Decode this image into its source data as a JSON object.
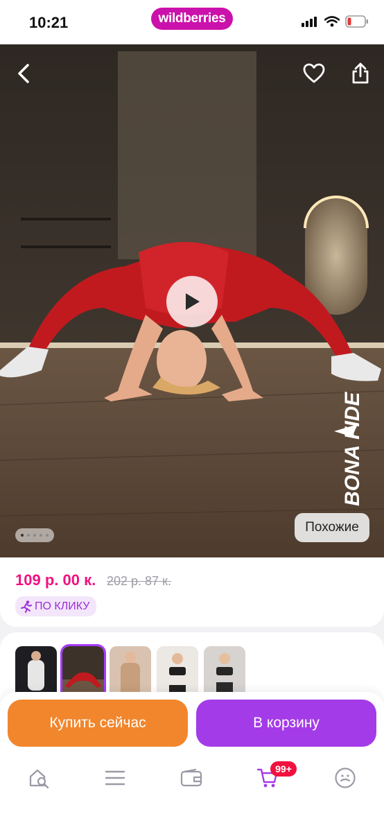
{
  "status_bar": {
    "time": "10:21",
    "brand": "wildberries",
    "icons": [
      "cellular-signal-icon",
      "wifi-icon",
      "battery-low-icon"
    ]
  },
  "hero": {
    "icons": [
      "back-arrow-icon",
      "heart-icon",
      "share-icon",
      "play-icon"
    ],
    "brand_logo": "BONA FIDE",
    "similar_label": "Похожие",
    "gallery_dots_total": 5,
    "gallery_dots_active": 1
  },
  "price": {
    "current": "109 р. 00 к.",
    "old": "202 р. 87 к.",
    "promo_label": "ПО КЛИКУ",
    "promo_icon": "running-person-icon"
  },
  "thumbnails": {
    "count": 5,
    "active_index": 1
  },
  "actions": {
    "buy_now": "Купить сейчас",
    "add_to_cart": "В корзину"
  },
  "bottom_nav": {
    "items": [
      "home-search-icon",
      "menu-icon",
      "wallet-icon",
      "cart-icon",
      "profile-icon"
    ],
    "cart_badge": "99+"
  },
  "colors": {
    "brand": "#cb11ab",
    "price": "#f1117e",
    "buy_now": "#f2862d",
    "add_to_cart": "#a43be8",
    "promo_bg": "#f3e6fb",
    "promo_text": "#9a2fd6",
    "badge": "#f1113f"
  }
}
